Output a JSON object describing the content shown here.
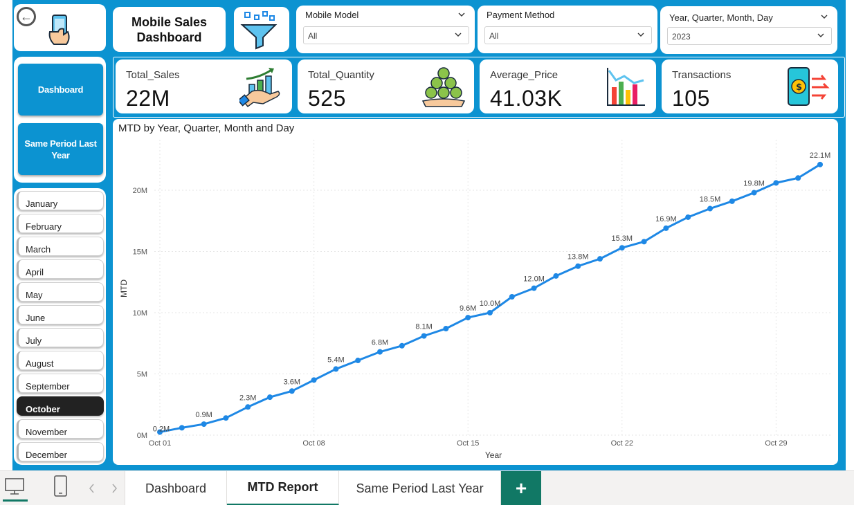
{
  "header": {
    "title_line1": "Mobile Sales",
    "title_line2": "Dashboard"
  },
  "nav": {
    "back_icon": "back-arrow-icon",
    "buttons": [
      "Dashboard",
      "Same Period Last Year"
    ]
  },
  "months": {
    "items": [
      "January",
      "February",
      "March",
      "April",
      "May",
      "June",
      "July",
      "August",
      "September",
      "October",
      "November",
      "December"
    ],
    "selected": "October"
  },
  "slicers": {
    "mobile_model": {
      "title": "Mobile Model",
      "value": "All"
    },
    "payment_method": {
      "title": "Payment Method",
      "value": "All"
    },
    "date": {
      "title": "Year, Quarter, Month, Day",
      "value": "2023"
    }
  },
  "kpis": [
    {
      "label": "Total_Sales",
      "value": "22M",
      "icon": "money-growth-icon"
    },
    {
      "label": "Total_Quantity",
      "value": "525",
      "icon": "coin-stack-icon"
    },
    {
      "label": "Average_Price",
      "value": "41.03K",
      "icon": "bar-chart-icon"
    },
    {
      "label": "Transactions",
      "value": "105",
      "icon": "mobile-payment-icon"
    }
  ],
  "chart_data": {
    "type": "line",
    "title": "MTD by Year, Quarter, Month and Day",
    "xlabel": "Year",
    "ylabel": "MTD",
    "x_ticks": [
      "Oct 01",
      "Oct 08",
      "Oct 15",
      "Oct 22",
      "Oct 29"
    ],
    "y_ticks": [
      "0M",
      "5M",
      "10M",
      "15M",
      "20M"
    ],
    "ylim": [
      0,
      23
    ],
    "color": "#1e88e5",
    "series": [
      {
        "days": [
          1,
          2,
          3,
          4,
          5,
          6,
          7,
          8,
          9,
          10,
          11,
          12,
          13,
          14,
          15,
          16,
          17,
          18,
          19,
          20,
          21,
          22,
          23,
          24,
          25,
          26,
          27,
          28,
          29,
          30,
          31
        ],
        "values": [
          0.25,
          0.6,
          0.9,
          1.4,
          2.3,
          3.1,
          3.6,
          4.5,
          5.4,
          6.1,
          6.8,
          7.3,
          8.1,
          8.7,
          9.6,
          10.0,
          11.3,
          12.0,
          13.0,
          13.8,
          14.4,
          15.3,
          15.8,
          16.9,
          17.8,
          18.5,
          19.1,
          19.8,
          20.6,
          21.0,
          22.1
        ]
      }
    ],
    "data_labels": [
      {
        "day": 1,
        "text": "0.2M"
      },
      {
        "day": 3,
        "text": "0.9M"
      },
      {
        "day": 5,
        "text": "2.3M"
      },
      {
        "day": 7,
        "text": "3.6M"
      },
      {
        "day": 9,
        "text": "5.4M"
      },
      {
        "day": 11,
        "text": "6.8M"
      },
      {
        "day": 13,
        "text": "8.1M"
      },
      {
        "day": 15,
        "text": "9.6M"
      },
      {
        "day": 16,
        "text": "10.0M"
      },
      {
        "day": 18,
        "text": "12.0M"
      },
      {
        "day": 20,
        "text": "13.8M"
      },
      {
        "day": 22,
        "text": "15.3M"
      },
      {
        "day": 24,
        "text": "16.9M"
      },
      {
        "day": 26,
        "text": "18.5M"
      },
      {
        "day": 28,
        "text": "19.8M"
      },
      {
        "day": 31,
        "text": "22.1M"
      }
    ]
  },
  "footer": {
    "desktop_icon": "desktop-view-icon",
    "mobile_icon": "mobile-view-icon",
    "tabs": [
      "Dashboard",
      "MTD Report",
      "Same Period Last Year"
    ],
    "active_tab": "MTD Report",
    "add_label": "+"
  }
}
